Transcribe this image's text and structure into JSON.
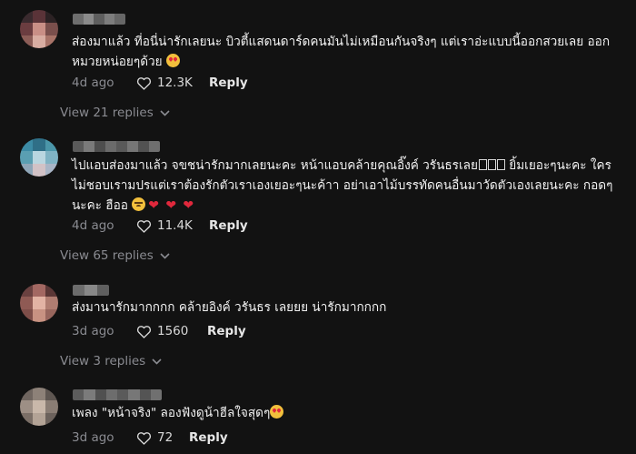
{
  "comments": [
    {
      "text": "ส่องมาแล้ว ที่อนี่น่ารักเลยนะ บิวตี้แสดนดาร์ดคนมันไม่เหมือนกันจริงๆ แต่เราอ่ะแบบนี้ออกสวยเลย ออกหมวยหน่อยๆด้วย",
      "time": "4d ago",
      "likes": "12.3K",
      "reply_label": "Reply",
      "view_replies": "View 21 replies",
      "emojis": [
        "smiling-face-with-hearts-emoji"
      ]
    },
    {
      "text_a": "ไปแอบส่องมาแล้ว จขชน่ารักมากเลยนะคะ หน้าแอบคล้ายคุณอิ๊งค์ วรันธรเลย",
      "text_b": " ยิ้มเยอะๆนะคะ ใครไม่ชอบเรามปรแต่เราต้องรักตัวเราเองเยอะๆนะค้าา อย่าเอาไม้บรรทัดคนอื่นมาวัดตัวเองเลยนะคะ กอดๆนะคะ ฮืออ",
      "time": "4d ago",
      "likes": "11.4K",
      "reply_label": "Reply",
      "view_replies": "View 65 replies",
      "emojis": [
        "sad-face-emoji",
        "red-heart-emoji",
        "red-heart-emoji",
        "red-heart-emoji"
      ]
    },
    {
      "text": "ส่งมานารักมากกกก คล้ายอิงค์ วรันธร เลยยย น่ารักมากกกก",
      "time": "3d ago",
      "likes": "1560",
      "reply_label": "Reply",
      "view_replies": "View 3 replies"
    },
    {
      "text": "เพลง \"หน้าจริง\" ลองฟังดูน้าฮีลใจสุดๆ",
      "time": "3d ago",
      "likes": "72",
      "reply_label": "Reply",
      "emojis": [
        "smiling-face-with-hearts-emoji"
      ]
    }
  ],
  "icons": {
    "heart": "heart-outline-icon",
    "chevron": "chevron-down-icon",
    "heart_emoji": "❤"
  },
  "colors": {
    "background": "#121212",
    "muted_text": "#8a8b91",
    "body_text": "#f1f1f1",
    "heart_red": "#e0283c"
  }
}
